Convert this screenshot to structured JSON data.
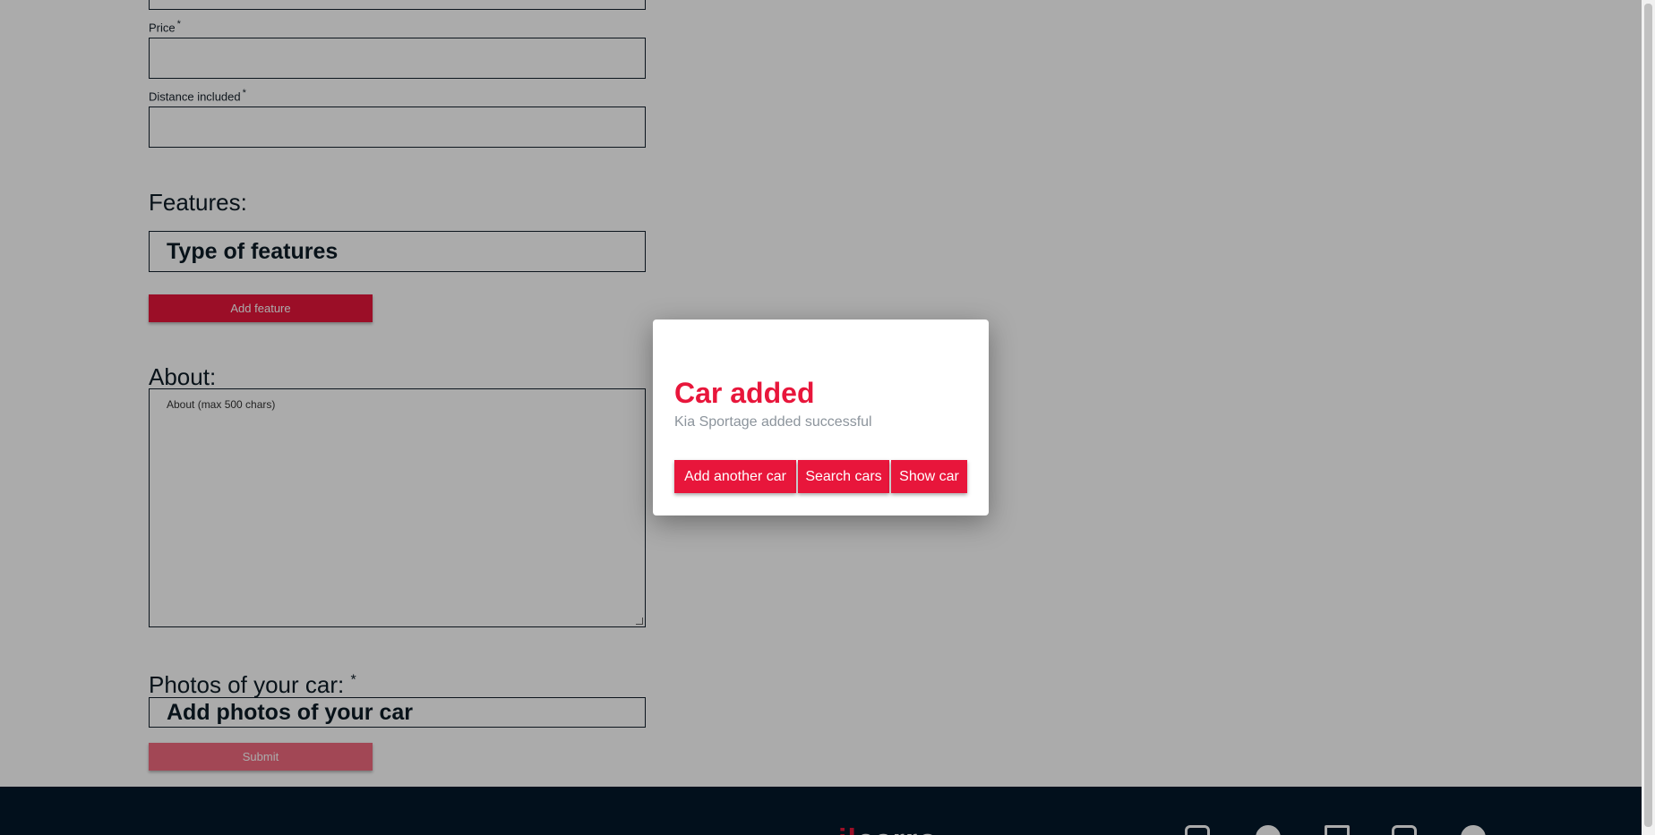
{
  "form": {
    "price_label": "Price",
    "distance_label": "Distance included",
    "required_mark": "*",
    "features_title": "Features:",
    "features_placeholder": "Type of features",
    "add_feature_label": "Add feature",
    "about_title": "About:",
    "about_placeholder": "About (max 500 chars)",
    "photos_title": "Photos of your car:",
    "photos_required_mark": "*",
    "photos_button_label": "Add photos of your car",
    "submit_label": "Submit"
  },
  "modal": {
    "title": "Car added",
    "message": "Kia Sportage added successful",
    "buttons": {
      "add_another": "Add another car",
      "search": "Search cars",
      "show": "Show car"
    }
  },
  "footer": {
    "logo_prefix": "il",
    "logo_main": "carro",
    "social_icons": [
      "facebook-icon",
      "messenger-icon",
      "twitter-icon",
      "instagram-icon",
      "settings-icon"
    ]
  },
  "colors": {
    "accent": "#e8163b",
    "footer_bg": "#03192a",
    "overlay": "rgba(0,0,0,0.33)"
  }
}
